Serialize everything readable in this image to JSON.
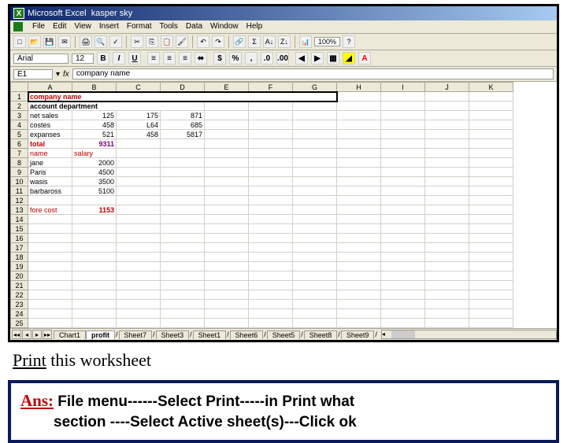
{
  "titlebar": {
    "app": "Microsoft Excel",
    "doc": "kasper sky"
  },
  "menubar": {
    "items": [
      "File",
      "Edit",
      "View",
      "Insert",
      "Format",
      "Tools",
      "Data",
      "Window",
      "Help"
    ]
  },
  "toolbar": {
    "zoom": "100%"
  },
  "format": {
    "font": "Arial",
    "size": "12"
  },
  "namebox": {
    "cell": "E1",
    "formula": "company name"
  },
  "columns": [
    "A",
    "B",
    "C",
    "D",
    "E",
    "F",
    "G",
    "H",
    "I",
    "J",
    "K"
  ],
  "rows": [
    "1",
    "2",
    "3",
    "4",
    "5",
    "6",
    "7",
    "8",
    "9",
    "10",
    "11",
    "12",
    "13",
    "14",
    "15",
    "16",
    "17",
    "18",
    "19",
    "20",
    "21",
    "22",
    "23",
    "24",
    "25"
  ],
  "data": {
    "title": "company name",
    "subtitle": "account department",
    "r3a": "net sales",
    "r3b": "125",
    "r3c": "175",
    "r3d": "871",
    "r4a": "costes",
    "r4b": "458",
    "r4c": "L64",
    "r4d": "685",
    "r5a": "expanses",
    "r5b": "521",
    "r5c": "458",
    "r5d": "5817",
    "r6a": "total",
    "r6b": "9311",
    "r7a": "name",
    "r7b": "salary",
    "r8a": "jane",
    "r8b": "2000",
    "r9a": "Paris",
    "r9b": "4500",
    "r10a": "wasis",
    "r10b": "3500",
    "r11a": "barbaross",
    "r11b": "5100",
    "r13a": "fore cost",
    "r13b": "1153"
  },
  "tabs": {
    "nav": [
      "◂◂",
      "◂",
      "▸",
      "▸▸"
    ],
    "items": [
      "Chart1",
      "profit",
      "Sheet7",
      "Sheet3",
      "Sheet1",
      "Sheet6",
      "Sheet5",
      "Sheet8",
      "Sheet9"
    ],
    "active": 1
  },
  "instruction": {
    "underline": "Print",
    "rest": " this worksheet"
  },
  "answer": {
    "label": "Ans:",
    "line1": " File menu------Select Print-----in Print what",
    "line2": "section ----Select Active sheet(s)---Click ok"
  }
}
